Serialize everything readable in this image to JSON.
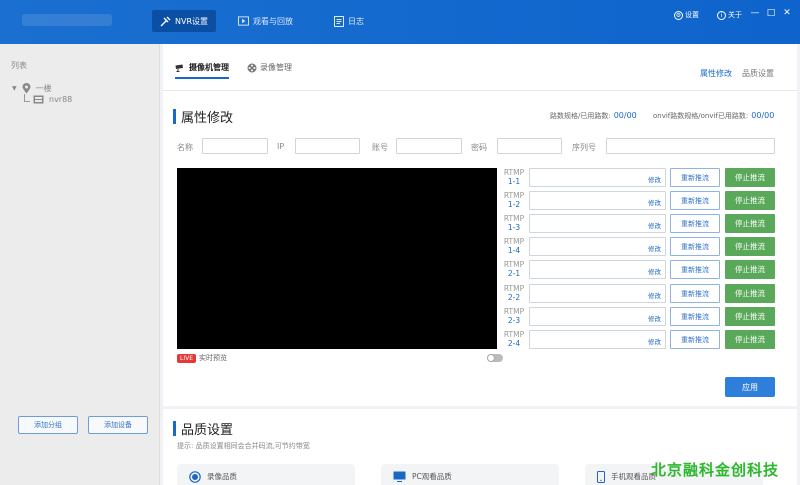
{
  "topbar": {
    "tabs": [
      {
        "label": "NVR设置",
        "icon": "wrench-icon",
        "active": true
      },
      {
        "label": "观看与回放",
        "icon": "play-icon",
        "active": false
      },
      {
        "label": "日志",
        "icon": "document-icon",
        "active": false
      }
    ],
    "settings_label": "设置",
    "about_label": "关于",
    "min_symbol": "—",
    "max_symbol": "□",
    "close_symbol": "✕"
  },
  "sidebar": {
    "title": "列表",
    "tree": [
      {
        "label": "一楼",
        "icon": "location-pin-icon"
      },
      {
        "label": "nvr88",
        "icon": "nvr-device-icon"
      }
    ],
    "add_group_label": "添加分组",
    "add_device_label": "添加设备"
  },
  "subtabs": {
    "camera_mgmt": "摄像机管理",
    "record_mgmt": "录像管理"
  },
  "right_tabs": {
    "attr_edit": "属性修改",
    "quality_set": "品质设置"
  },
  "attr_section": {
    "title": "属性修改",
    "channels_label": "路数规格/已用路数:",
    "channels_value": "00/00",
    "onvif_label": "onvif路数规格/onvif已用路数:",
    "onvif_value": "00/00",
    "fields": {
      "name": "名称",
      "ip": "IP",
      "account": "账号",
      "password": "密码",
      "serial": "序列号"
    },
    "live_badge": "LIVE",
    "live_label": "实时预览",
    "rtmp": [
      {
        "line1": "RTMP",
        "line2": "1-1"
      },
      {
        "line1": "RTMP",
        "line2": "1-2"
      },
      {
        "line1": "RTMP",
        "line2": "1-3"
      },
      {
        "line1": "RTMP",
        "line2": "1-4"
      },
      {
        "line1": "RTMP",
        "line2": "2-1"
      },
      {
        "line1": "RTMP",
        "line2": "2-2"
      },
      {
        "line1": "RTMP",
        "line2": "2-3"
      },
      {
        "line1": "RTMP",
        "line2": "2-4"
      }
    ],
    "edit_label": "修改",
    "restart_label": "重新推流",
    "stop_label": "停止推流",
    "apply_label": "应用"
  },
  "quality_section": {
    "title": "品质设置",
    "hint": "提示: 品质设置相同会合并码流,可节约带宽",
    "cards": [
      {
        "label": "录像品质",
        "icon": "radio-selected-icon"
      },
      {
        "label": "PC观看品质",
        "icon": "monitor-icon"
      },
      {
        "label": "手机观看品质",
        "icon": "phone-icon"
      }
    ]
  },
  "watermark": "北京融科金创科技",
  "colors": {
    "brand_blue": "#1a68c6",
    "topbar": "#0e64cc",
    "stop_green": "#5aa85a",
    "watermark_green": "#2db82d",
    "live_red": "#e53935"
  }
}
